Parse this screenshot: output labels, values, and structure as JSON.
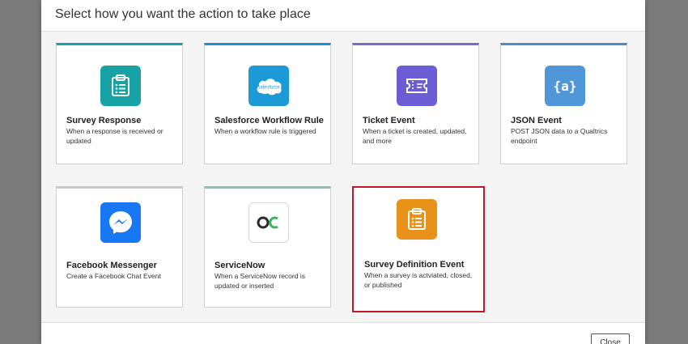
{
  "dialog": {
    "title": "Select how you want the action to take place"
  },
  "cards": [
    {
      "title": "Survey Response",
      "description": "When a response is received or updated",
      "accent": "#17a3a6",
      "icon": "clipboard-icon",
      "icon_bg": "#17a3a6"
    },
    {
      "title": "Salesforce Workflow Rule",
      "description": "When a workflow rule is triggered",
      "accent": "#1c8fd1",
      "icon": "salesforce-icon",
      "icon_bg": "#1c9ad6",
      "icon_text": "salesforce"
    },
    {
      "title": "Ticket Event",
      "description": "When a ticket is created, updated, and more",
      "accent": "#7a6bc4",
      "icon": "ticket-icon",
      "icon_bg": "#6b5dd3"
    },
    {
      "title": "JSON Event",
      "description": "POST JSON data to a Qualtrics endpoint",
      "accent": "#4a8dc9",
      "icon": "json-braces-icon",
      "icon_bg": "#4f97d8",
      "icon_text": "{a}"
    },
    {
      "title": "Facebook Messenger",
      "description": "Create a Facebook Chat Event",
      "accent": "#c8c8c8",
      "icon": "messenger-icon",
      "icon_bg": "#1877f2"
    },
    {
      "title": "ServiceNow",
      "description": "When a ServiceNow record is updated or inserted",
      "accent": "#9bbcae",
      "icon": "servicenow-icon",
      "icon_bg": "#ffffff"
    },
    {
      "title": "Survey Definition Event",
      "description": "When a survey is actviated, closed, or published",
      "accent": "#c0182a",
      "icon": "clipboard-icon",
      "icon_bg": "#e8921a",
      "selected": true
    }
  ],
  "footer": {
    "close_label": "Close"
  }
}
